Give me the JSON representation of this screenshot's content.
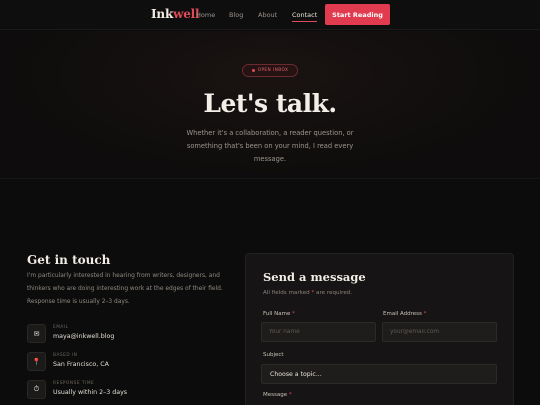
{
  "nav": {
    "brand_main": "Ink",
    "brand_accent": "well",
    "links": [
      "Home",
      "Blog",
      "About",
      "Contact"
    ],
    "active": "Contact",
    "cta": "Start Reading"
  },
  "hero": {
    "badge": "OPEN INBOX",
    "title": "Let's talk.",
    "subtitle": "Whether it's a collaboration, a reader question, or something that's been on your mind, I read every message."
  },
  "contact": {
    "title": "Get in touch",
    "text": "I'm particularly interested in hearing from writers, designers, and thinkers who are doing interesting work at the edges of their field. Response time is usually 2–3 days.",
    "items": [
      {
        "label": "EMAIL",
        "value": "maya@inkwell.blog",
        "icon": "mail-icon"
      },
      {
        "label": "BASED IN",
        "value": "San Francisco, CA",
        "icon": "location-pin-icon"
      },
      {
        "label": "RESPONSE TIME",
        "value": "Usually within 2–3 days",
        "icon": "stopwatch-icon"
      }
    ]
  },
  "form": {
    "title": "Send a message",
    "note_prefix": "All fields marked ",
    "note_star": "*",
    "note_suffix": " are required.",
    "full_name_label": "Full Name",
    "full_name_placeholder": "Your name",
    "email_label": "Email Address",
    "email_placeholder": "your@email.com",
    "subject_label": "Subject",
    "subject_value": "Choose a topic...",
    "message_label": "Message",
    "required_star": "*"
  },
  "colors": {
    "accent": "#e03b4f",
    "background": "#0d0c0c",
    "card": "#161414"
  }
}
